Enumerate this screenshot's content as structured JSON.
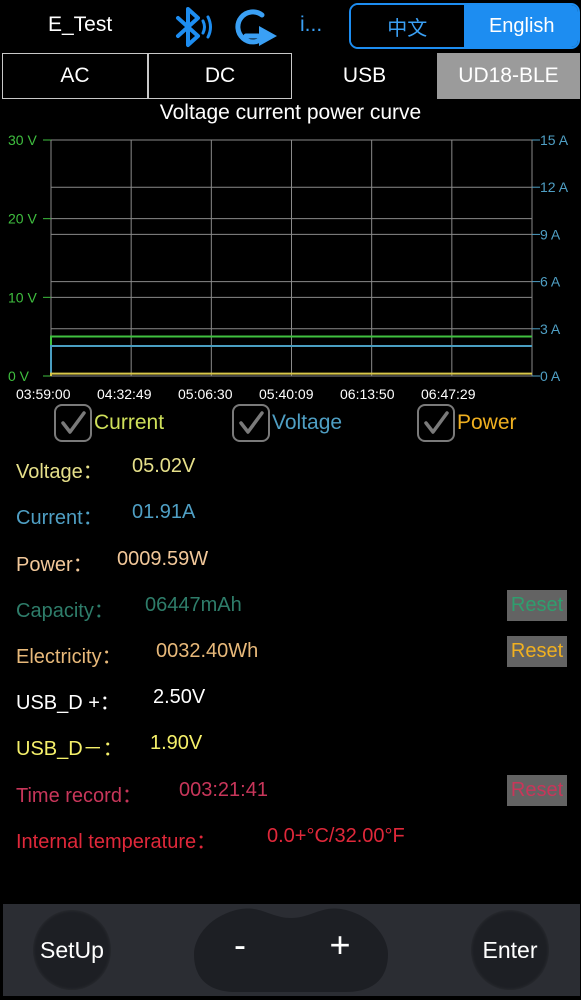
{
  "header": {
    "app_title": "E_Test",
    "device_short": "i...",
    "lang_chinese": "中文",
    "lang_english": "English",
    "active_lang": "English",
    "bt_color": "#1d8df1"
  },
  "tabs": [
    {
      "label": "AC"
    },
    {
      "label": "DC"
    },
    {
      "label": "USB"
    },
    {
      "label": "UD18-BLE",
      "selected": true
    }
  ],
  "chart_data": {
    "type": "line",
    "title": "Voltage current power curve",
    "x": [
      "03:59:00",
      "04:32:49",
      "05:06:30",
      "05:40:09",
      "06:13:50",
      "06:47:29"
    ],
    "y_left": {
      "unit": "V",
      "ticks": [
        "30 V",
        "20 V",
        "10 V",
        "0 V"
      ],
      "range": [
        0,
        30
      ],
      "color": "#3fbf3f"
    },
    "y_right": {
      "unit": "A",
      "ticks": [
        "15 A",
        "12 A",
        "9 A",
        "6 A",
        "3 A",
        "0 A"
      ],
      "range": [
        0,
        15
      ],
      "color": "#4f9fc4"
    },
    "grid": true,
    "series": [
      {
        "name": "Voltage",
        "axis": "left",
        "values": [
          5.02,
          5.02,
          5.02,
          5.02,
          5.02,
          5.02
        ],
        "color": "#40c040"
      },
      {
        "name": "Current",
        "axis": "right",
        "values": [
          1.91,
          1.91,
          1.91,
          1.91,
          1.91,
          1.91
        ],
        "color": "#4a9ec2"
      },
      {
        "name": "Power",
        "axis": "left",
        "values": [
          0.3,
          0.3,
          0.3,
          0.3,
          0.3,
          0.3
        ],
        "color": "#d9c84a"
      }
    ]
  },
  "checkboxes": {
    "current": {
      "label": "Current",
      "checked": true,
      "color": "#cfe05a"
    },
    "voltage": {
      "label": "Voltage",
      "checked": true,
      "color": "#4f9fc4"
    },
    "power": {
      "label": "Power",
      "checked": true,
      "color": "#f0b020"
    }
  },
  "readings": {
    "voltage": {
      "label": "Voltage：",
      "value": "05.02V",
      "color": "#e6e08a"
    },
    "current": {
      "label": "Current：",
      "value": "01.91A",
      "color": "#4f9fc4"
    },
    "power": {
      "label": "Power：",
      "value": "0009.59W",
      "color": "#f2c89a"
    },
    "capacity": {
      "label": "Capacity：",
      "value": "06447mAh",
      "color": "#2e7d6a"
    },
    "electricity": {
      "label": "Electricity：",
      "value": "0032.40Wh",
      "color": "#e8b97a"
    },
    "usb_dp": {
      "label": "USB_D +：",
      "value": "2.50V",
      "color": "#ffffff"
    },
    "usb_dm": {
      "label": "USB_D－：",
      "value": "1.90V",
      "color": "#f5f06a"
    },
    "time_record": {
      "label": "Time record：",
      "value": "003:21:41",
      "color": "#c8365a"
    },
    "internal_temp": {
      "label": "Internal temperature：",
      "value": "0.0+°C/32.00°F",
      "color": "#e0283a"
    }
  },
  "reset": {
    "capacity": "Reset",
    "electricity": "Reset",
    "time": "Reset"
  },
  "bottom": {
    "setup": "SetUp",
    "minus": "-",
    "plus": "+",
    "enter": "Enter"
  }
}
